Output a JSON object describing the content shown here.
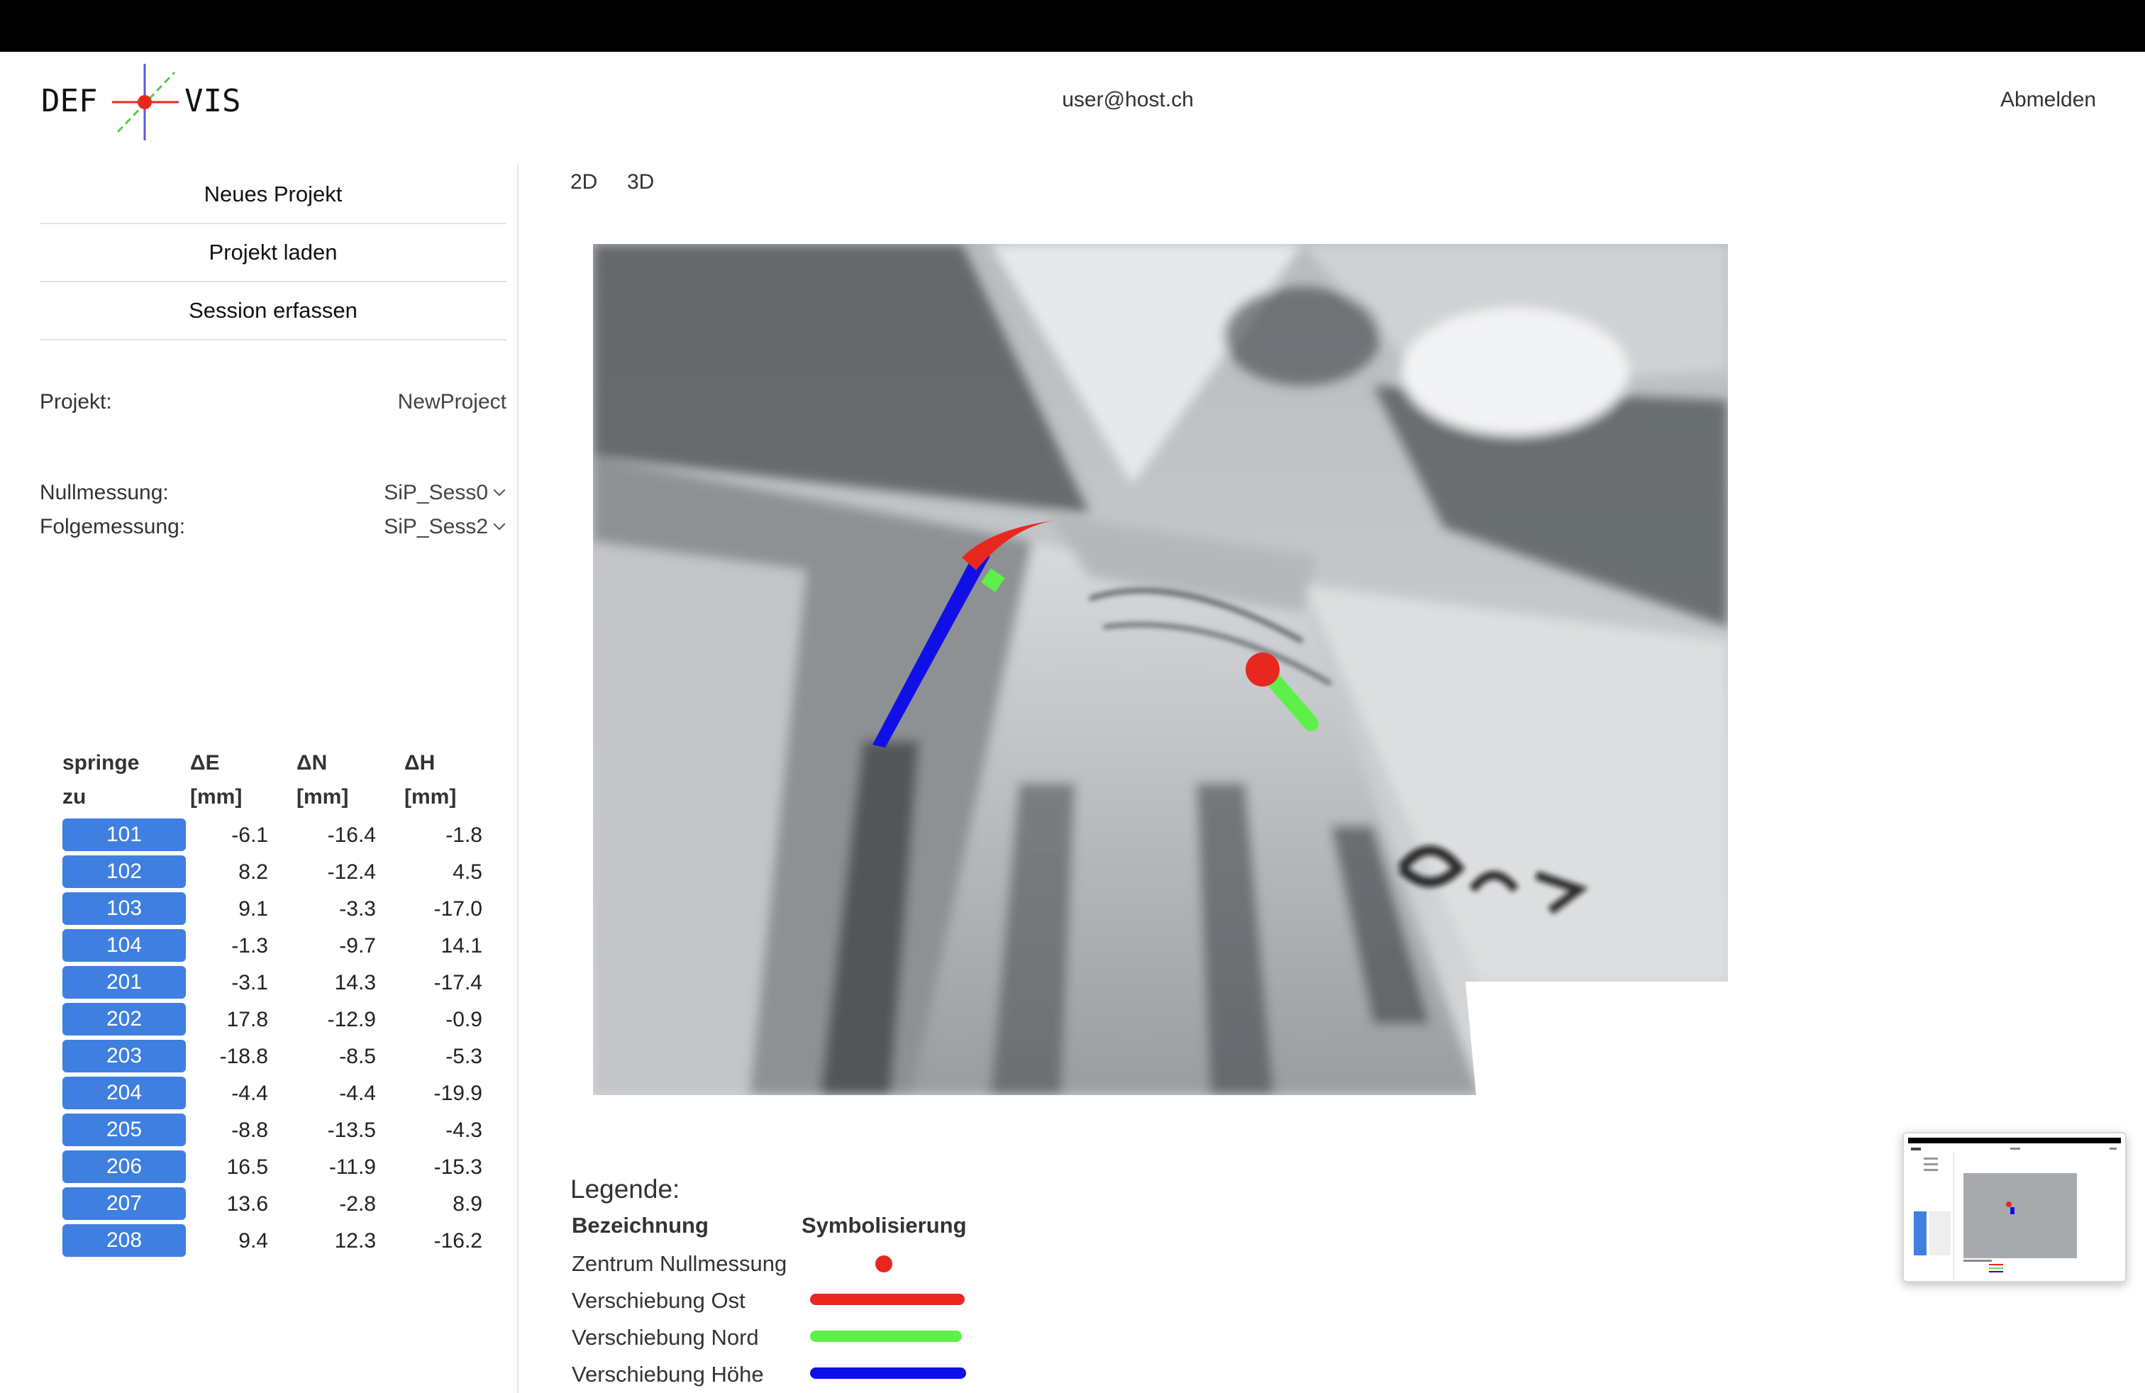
{
  "header": {
    "logo_left": "DEF",
    "logo_right": "VIS",
    "user_email": "user@host.ch",
    "logout_label": "Abmelden"
  },
  "sidebar": {
    "buttons": [
      "Neues Projekt",
      "Projekt laden",
      "Session erfassen"
    ],
    "project_label": "Projekt:",
    "project_value": "NewProject",
    "zero_label": "Nullmessung:",
    "zero_value": "SiP_Sess0",
    "follow_label": "Folgemessung:",
    "follow_value": "SiP_Sess2"
  },
  "table": {
    "headers": {
      "jump_line1": "springe",
      "jump_line2": "zu",
      "de_line1": "ΔE",
      "de_line2": "[mm]",
      "dn_line1": "ΔN",
      "dn_line2": "[mm]",
      "dh_line1": "ΔH",
      "dh_line2": "[mm]"
    },
    "rows": [
      {
        "id": "101",
        "de": "-6.1",
        "dn": "-16.4",
        "dh": "-1.8"
      },
      {
        "id": "102",
        "de": "8.2",
        "dn": "-12.4",
        "dh": "4.5"
      },
      {
        "id": "103",
        "de": "9.1",
        "dn": "-3.3",
        "dh": "-17.0"
      },
      {
        "id": "104",
        "de": "-1.3",
        "dn": "-9.7",
        "dh": "14.1"
      },
      {
        "id": "201",
        "de": "-3.1",
        "dn": "14.3",
        "dh": "-17.4"
      },
      {
        "id": "202",
        "de": "17.8",
        "dn": "-12.9",
        "dh": "-0.9"
      },
      {
        "id": "203",
        "de": "-18.8",
        "dn": "-8.5",
        "dh": "-5.3"
      },
      {
        "id": "204",
        "de": "-4.4",
        "dn": "-4.4",
        "dh": "-19.9"
      },
      {
        "id": "205",
        "de": "-8.8",
        "dn": "-13.5",
        "dh": "-4.3"
      },
      {
        "id": "206",
        "de": "16.5",
        "dn": "-11.9",
        "dh": "-15.3"
      },
      {
        "id": "207",
        "de": "13.6",
        "dn": "-2.8",
        "dh": "8.9"
      },
      {
        "id": "208",
        "de": "9.4",
        "dn": "12.3",
        "dh": "-16.2"
      }
    ]
  },
  "view_tabs": [
    "2D",
    "3D"
  ],
  "legend": {
    "title": "Legende:",
    "col_name": "Bezeichnung",
    "col_symbol": "Symbolisierung",
    "items": [
      {
        "label": "Zentrum Nullmessung",
        "color": "#e8281e",
        "symbol": "dot"
      },
      {
        "label": "Verschiebung Ost",
        "color": "#e8281e",
        "symbol": "line"
      },
      {
        "label": "Verschiebung Nord",
        "color": "#5ef04a",
        "symbol": "line"
      },
      {
        "label": "Verschiebung Höhe",
        "color": "#1010e6",
        "symbol": "line"
      }
    ]
  },
  "colors": {
    "accent_button": "#3f7fe0",
    "east": "#e8281e",
    "north": "#5ef04a",
    "height": "#1010e6"
  }
}
